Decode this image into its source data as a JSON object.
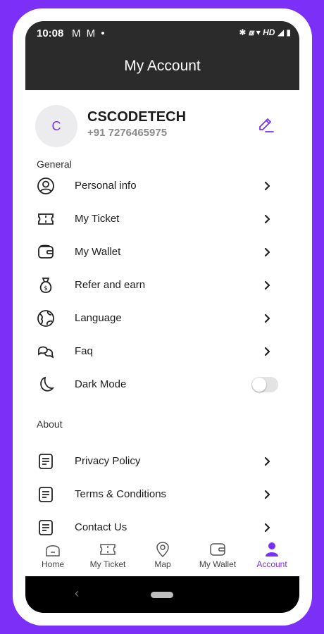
{
  "status": {
    "time": "10:08",
    "notifications": "M M •",
    "system": "HD"
  },
  "header": {
    "title": "My Account"
  },
  "profile": {
    "initial": "C",
    "name": "CSCODETECH",
    "phone": "+91 7276465975"
  },
  "sections": {
    "general": "General",
    "about": "About"
  },
  "general_items": [
    {
      "label": "Personal info",
      "icon": "user-circle-icon"
    },
    {
      "label": "My Ticket",
      "icon": "ticket-icon"
    },
    {
      "label": "My Wallet",
      "icon": "wallet-icon"
    },
    {
      "label": "Refer and earn",
      "icon": "money-bag-icon"
    },
    {
      "label": "Language",
      "icon": "globe-icon"
    },
    {
      "label": "Faq",
      "icon": "chat-icon"
    },
    {
      "label": "Dark Mode",
      "icon": "moon-icon",
      "toggle": false
    }
  ],
  "about_items": [
    {
      "label": "Privacy Policy",
      "icon": "document-icon"
    },
    {
      "label": "Terms & Conditions",
      "icon": "document-icon"
    },
    {
      "label": "Contact Us",
      "icon": "document-icon"
    }
  ],
  "bottom_nav": [
    {
      "label": "Home",
      "icon": "home-icon"
    },
    {
      "label": "My Ticket",
      "icon": "ticket-icon"
    },
    {
      "label": "Map",
      "icon": "map-pin-icon"
    },
    {
      "label": "My Wallet",
      "icon": "wallet-icon"
    },
    {
      "label": "Account",
      "icon": "account-icon",
      "active": true
    }
  ],
  "colors": {
    "accent": "#7b2ff7",
    "background": "#7b2ff7",
    "header": "#2b2b2b"
  }
}
